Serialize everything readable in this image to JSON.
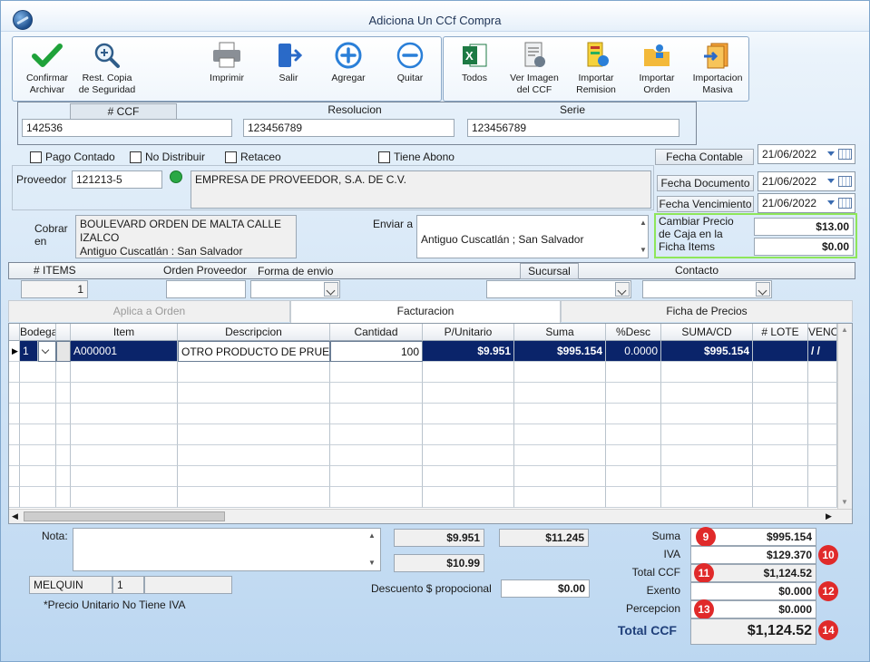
{
  "window": {
    "title": "Adiciona Un CCf Compra"
  },
  "toolbar": {
    "confirmar": "Confirmar\nArchivar",
    "rest": "Rest. Copia\nde Seguridad",
    "imprimir": "Imprimir",
    "salir": "Salir",
    "agregar": "Agregar",
    "quitar": "Quitar",
    "todos": "Todos",
    "ver_imagen": "Ver Imagen\ndel CCF",
    "importar_remision": "Importar\nRemision",
    "importar_orden": "Importar\nOrden",
    "importacion_masiva": "Importacion\nMasiva"
  },
  "header": {
    "ccf_label": "# CCF",
    "ccf_value": "142536",
    "resolucion_label": "Resolucion",
    "resolucion_value": "123456789",
    "serie_label": "Serie",
    "serie_value": "123456789"
  },
  "options": {
    "pago_contado": "Pago Contado",
    "no_distribuir": "No Distribuir",
    "retaceo": "Retaceo",
    "tiene_abono": "Tiene Abono",
    "fecha_contable_label": "Fecha Contable",
    "fecha_contable": "21/06/2022"
  },
  "proveedor": {
    "label": "Proveedor",
    "code": "121213-5",
    "name": "EMPRESA DE PROVEEDOR, S.A. DE C.V.",
    "fecha_documento_label": "Fecha Documento",
    "fecha_documento": "21/06/2022",
    "fecha_vencimiento_label": "Fecha Vencimiento",
    "fecha_vencimiento": "21/06/2022"
  },
  "cobrar": {
    "label": "Cobrar\nen",
    "line1": "BOULEVARD ORDEN DE MALTA CALLE",
    "line2": "IZALCO",
    "line3": "Antiguo Cuscatlán : San Salvador",
    "enviar_label": "Enviar a",
    "enviar_value": "Antiguo Cuscatlán ; San Salvador"
  },
  "precio_caja": {
    "label": "Cambiar Precio\nde Caja en la\nFicha Items",
    "value1": "$13.00",
    "value2": "$0.00"
  },
  "info_bar": {
    "items_label": "# ITEMS",
    "items_value": "1",
    "orden_label": "Orden Proveedor",
    "forma_label": "Forma de envio",
    "sucursal_label": "Sucursal",
    "contacto_label": "Contacto"
  },
  "tabs": {
    "aplica": "Aplica a Orden",
    "facturacion": "Facturacion",
    "ficha": "Ficha de Precios"
  },
  "grid": {
    "headers": [
      "Bodega",
      "",
      "Item",
      "Descripcion",
      "Cantidad",
      "P/Unitario",
      "Suma",
      "%Desc",
      "SUMA/CD",
      "# LOTE",
      "VENC"
    ],
    "row": {
      "bodega": "1",
      "item": "A000001",
      "descripcion": "OTRO PRODUCTO DE PRUEBA",
      "cantidad": "100",
      "punitario": "$9.951",
      "suma": "$995.154",
      "desc": "0.0000",
      "sumacd": "$995.154",
      "venc": "/ /"
    }
  },
  "footer": {
    "nota_label": "Nota:",
    "val_a": "$9.951",
    "val_b": "$11.245",
    "val_c": "$10.99",
    "user": "MELQUIN",
    "user_num": "1",
    "nota_iva": "*Precio Unitario No Tiene IVA",
    "descuento_label": "Descuento $ propocional",
    "descuento_value": "$0.00"
  },
  "totals": {
    "suma_label": "Suma",
    "suma": "$995.154",
    "suma_badge": "9",
    "iva_label": "IVA",
    "iva": "$129.370",
    "iva_badge": "10",
    "total_ccf_label": "Total CCF",
    "total_ccf": "$1,124.52",
    "total_badge": "11",
    "exento_label": "Exento",
    "exento": "$0.000",
    "exento_badge": "12",
    "percepcion_label": "Percepcion",
    "percepcion": "$0.000",
    "percepcion_badge": "13",
    "grand_label": "Total CCF",
    "grand": "$1,124.52",
    "grand_badge": "14"
  }
}
